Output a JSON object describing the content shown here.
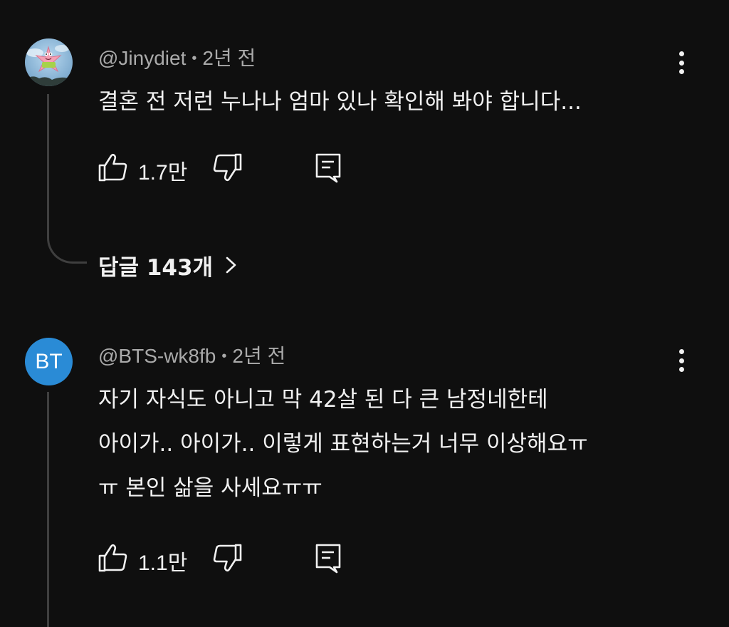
{
  "comments": [
    {
      "author": "@Jinydiet",
      "separator": "•",
      "time": "2년 전",
      "lines": [
        "결혼 전 저런 누나나 엄마 있나 확인해 봐야 합니다..."
      ],
      "likes": "1.7만",
      "avatar_icon": "starfish-cartoon-avatar",
      "replies_label": "답글 143개"
    },
    {
      "author": "@BTS-wk8fb",
      "separator": "•",
      "time": "2년 전",
      "lines": [
        "자기 자식도 아니고 막 42살 된 다 큰 남정네한테",
        "아이가.. 아이가.. 이렇게 표현하는거 너무 이상해요ㅠ",
        "ㅠ 본인 삶을 사세요ㅠㅠ"
      ],
      "likes": "1.1만",
      "avatar_initials": "BT",
      "avatar_color": "#2a8bd6"
    }
  ],
  "icons": {
    "like": "thumbs-up-icon",
    "dislike": "thumbs-down-icon",
    "reply": "reply-comment-icon",
    "more": "more-vert-icon",
    "chevron": "chevron-right-icon"
  },
  "colors": {
    "background": "#0f0f0f",
    "text": "#f1f1f1",
    "meta": "#aaaaaa",
    "thread_line": "#3f3f3f"
  }
}
